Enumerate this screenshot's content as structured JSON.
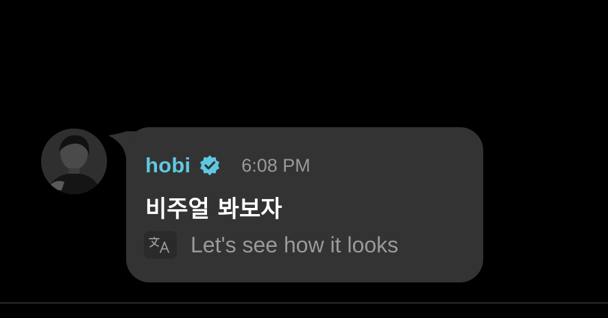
{
  "message": {
    "sender": {
      "username": "hobi",
      "verified": true,
      "avatar_icon": "profile-photo"
    },
    "timestamp": "6:08 PM",
    "text": "비주얼 봐보자",
    "translation": "Let's see how it looks",
    "translate_icon": "translate-icon"
  },
  "colors": {
    "background": "#000000",
    "bubble": "#333333",
    "username": "#5fc8e0",
    "verified_badge": "#5fc8e0",
    "secondary_text": "#9a9a9a",
    "message_text": "#ffffff"
  }
}
